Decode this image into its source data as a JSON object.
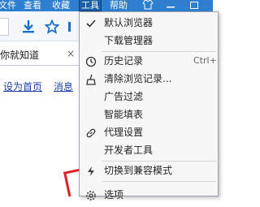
{
  "menubar": {
    "items": [
      {
        "label": "文件"
      },
      {
        "label": "查看"
      },
      {
        "label": "收藏"
      },
      {
        "label": "工具",
        "active": true
      },
      {
        "label": "帮助"
      }
    ]
  },
  "tab": {
    "title": "你就知道",
    "close_glyph": "×"
  },
  "links": {
    "home": "设为首页",
    "news": "消息"
  },
  "tools_menu": {
    "items": [
      {
        "label": "默认浏览器",
        "icon": "check-icon",
        "shortcut": ""
      },
      {
        "label": "下载管理器",
        "icon": "",
        "shortcut": ""
      },
      {
        "label": "历史记录",
        "icon": "clock-icon",
        "shortcut": "Ctrl+"
      },
      {
        "label": "清除浏览记录...",
        "icon": "broom-icon",
        "shortcut": ""
      },
      {
        "label": "广告过滤",
        "icon": "",
        "shortcut": ""
      },
      {
        "label": "智能填表",
        "icon": "",
        "shortcut": ""
      },
      {
        "label": "代理设置",
        "icon": "link-icon",
        "shortcut": ""
      },
      {
        "label": "开发者工具",
        "icon": "",
        "shortcut": ""
      },
      {
        "label": "切换到兼容模式",
        "icon": "lightning-icon",
        "shortcut": ""
      },
      {
        "label": "选项",
        "icon": "gear-icon",
        "shortcut": ""
      }
    ]
  },
  "colors": {
    "menubar_bg": "#2f7fd0",
    "menu_bg": "#f7f7f7",
    "toolbar_accent": "#1e6fc6"
  }
}
